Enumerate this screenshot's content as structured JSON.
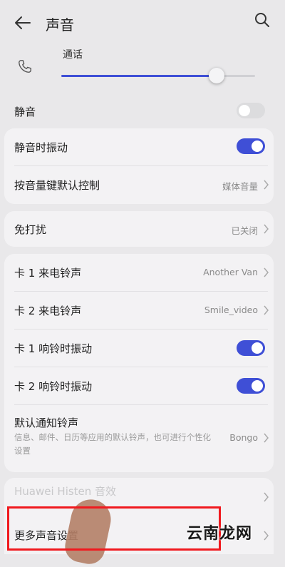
{
  "header": {
    "title": "声音",
    "back_icon": "back-arrow-icon",
    "search_icon": "search-icon"
  },
  "volume": {
    "label": "通话",
    "level_percent": 80,
    "icon": "phone-icon"
  },
  "rows": {
    "mute": {
      "label": "静音",
      "toggle": false
    },
    "vibrate_when_silent": {
      "label": "静音时振动",
      "toggle": true
    },
    "volume_key_control": {
      "label": "按音量键默认控制",
      "value": "媒体音量"
    },
    "do_not_disturb": {
      "label": "免打扰",
      "value": "已关闭"
    },
    "sim1_ringtone": {
      "label": "卡 1 来电铃声",
      "value": "Another Van"
    },
    "sim2_ringtone": {
      "label": "卡 2 来电铃声",
      "value": "Smile_video"
    },
    "sim1_vibrate": {
      "label": "卡 1 响铃时振动",
      "toggle": true
    },
    "sim2_vibrate": {
      "label": "卡 2 响铃时振动",
      "toggle": true
    },
    "notification_tone": {
      "label": "默认通知铃声",
      "desc": "信息、邮件、日历等应用的默认铃声，也可进行个性化设置",
      "value": "Bongo"
    },
    "histen": {
      "label": "Huawei Histen 音效"
    },
    "more_sound": {
      "label": "更多声音设置"
    }
  },
  "watermark": "云南龙网",
  "colors": {
    "accent": "#3f4fd6",
    "highlight": "#f0191e"
  }
}
